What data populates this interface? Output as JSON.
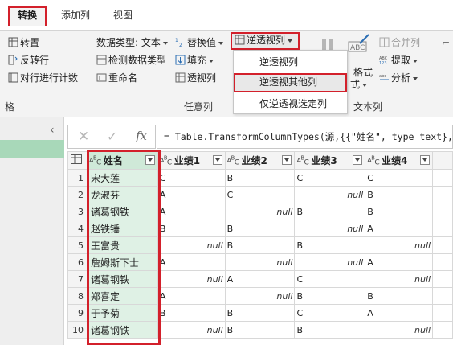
{
  "tabs": {
    "transform": "转换",
    "add_column": "添加列",
    "view": "视图"
  },
  "ribbon": {
    "transpose": "转置",
    "reverse_rows": "反转行",
    "count_rows": "对行进行计数",
    "data_type": "数据类型: 文本",
    "detect_type": "检测数据类型",
    "rename": "重命名",
    "replace_values": "替换值",
    "fill": "填充",
    "pivot_column": "透视列",
    "unpivot_columns": "逆透视列",
    "merge_columns": "合并列",
    "extract": "提取",
    "parse": "分析",
    "format": "格式",
    "format_suffix": "式",
    "group_any_column": "任意列",
    "group_text_column": "文本列",
    "group_table_partial": "格"
  },
  "unpivot_menu": {
    "items": [
      "逆透视列",
      "逆透视其他列",
      "仅逆透视选定列"
    ]
  },
  "formula_bar": {
    "text": "= Table.TransformColumnTypes(源,{{\"姓名\", type text},"
  },
  "grid": {
    "headers": [
      "姓名",
      "业绩1",
      "业绩2",
      "业绩3",
      "业绩4"
    ],
    "rows": [
      {
        "n": "1",
        "name": "宋大莲",
        "c1": "C",
        "c2": "B",
        "c3": "C",
        "c4": "C"
      },
      {
        "n": "2",
        "name": "龙淑芬",
        "c1": "A",
        "c2": "C",
        "c3": "null",
        "c4": "B"
      },
      {
        "n": "3",
        "name": "诸葛钢铁",
        "c1": "A",
        "c2": "null",
        "c3": "B",
        "c4": "B"
      },
      {
        "n": "4",
        "name": "赵铁锤",
        "c1": "B",
        "c2": "B",
        "c3": "null",
        "c4": "A"
      },
      {
        "n": "5",
        "name": "王富贵",
        "c1": "null",
        "c2": "B",
        "c3": "B",
        "c4": "null"
      },
      {
        "n": "6",
        "name": "詹姆斯下士",
        "c1": "A",
        "c2": "null",
        "c3": "null",
        "c4": "A"
      },
      {
        "n": "7",
        "name": "诸葛钢铁",
        "c1": "null",
        "c2": "A",
        "c3": "C",
        "c4": "null"
      },
      {
        "n": "8",
        "name": "郑喜定",
        "c1": "A",
        "c2": "null",
        "c3": "B",
        "c4": "B"
      },
      {
        "n": "9",
        "name": "于予菊",
        "c1": "B",
        "c2": "B",
        "c3": "C",
        "c4": "A"
      },
      {
        "n": "10",
        "name": "诸葛钢铁",
        "c1": "null",
        "c2": "B",
        "c3": "B",
        "c4": "null"
      }
    ]
  },
  "colors": {
    "highlight_red": "#d3202b",
    "name_column_green": "#dff1e5",
    "sidebar_selected": "#a8d8b9"
  }
}
